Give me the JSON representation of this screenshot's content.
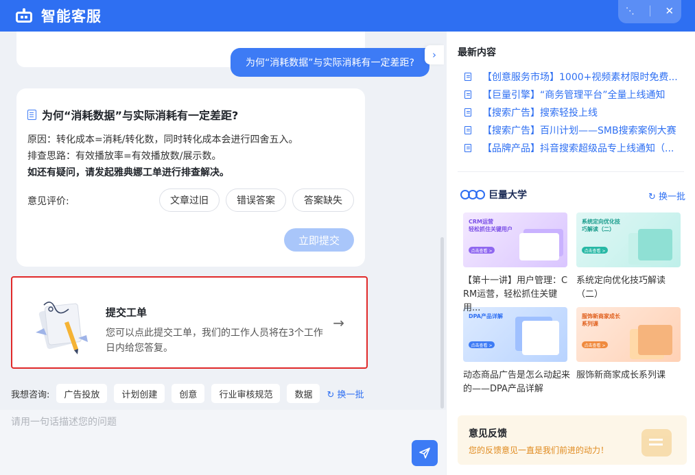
{
  "header": {
    "title": "智能客服"
  },
  "chat": {
    "user_message": "为何“消耗数据”与实际消耗有一定差距?",
    "answer": {
      "question": "为何“消耗数据”与实际消耗有一定差距?",
      "line1": "原因：转化成本=消耗/转化数，同时转化成本会进行四舍五入。",
      "line2": "排查思路：有效播放率=有效播放数/展示数。",
      "line3": "如还有疑问，请发起雅典娜工单进行排查解决。",
      "feedback_label": "意见评价:",
      "feedback_options": [
        "文章过旧",
        "错误答案",
        "答案缺失"
      ],
      "submit_label": "立即提交"
    },
    "ticket": {
      "title": "提交工单",
      "description": "您可以点此提交工单，我们的工作人员将在3个工作日内给您答复。"
    },
    "consult": {
      "label": "我想咨询:",
      "chips": [
        "广告投放",
        "计划创建",
        "创意",
        "行业审核规范",
        "数据"
      ],
      "batch_label": "换一批"
    },
    "input": {
      "placeholder": "请用一句话描述您的问题"
    }
  },
  "sidebar": {
    "latest_title": "最新内容",
    "news": [
      "【创意服务市场】1000+视频素材限时免费...",
      "【巨量引擎】“商务管理平台”全量上线通知",
      "【搜索广告】搜索轻投上线",
      "【搜索广告】百川计划——SMB搜索案例大赛",
      "【品牌产品】抖音搜索超级品专上线通知（..."
    ],
    "university": {
      "name": "巨量大学",
      "batch_label": "换一批",
      "courses": [
        {
          "caption_line1": "【第十一讲】用户管理：C",
          "caption_line2": "RM运营，轻松抓住关键用...",
          "thumb_title": "CRM运营\n轻松抓住关键用户",
          "thumb_btn": "点击查看 >"
        },
        {
          "caption_line1": "系统定向优化技巧解读",
          "caption_line2": "（二）",
          "thumb_title": "系统定向优化技\n巧解读（二）",
          "thumb_btn": "点击查看 >"
        },
        {
          "caption_line1": "动态商品广告是怎么动起来",
          "caption_line2": "的——DPA产品详解",
          "thumb_title": "DPA产品详解",
          "thumb_btn": "点击查看 >"
        },
        {
          "caption_line1": "服饰新商家成长系列课",
          "caption_line2": "",
          "thumb_title": "服饰新商家成长\n系列课",
          "thumb_btn": "点击查看 >"
        }
      ]
    },
    "feedback": {
      "title": "意见反馈",
      "description": "您的反馈意见一直是我们前进的动力！"
    }
  },
  "colors": {
    "primary": "#2e6ff2",
    "highlight_border": "#e02828"
  }
}
